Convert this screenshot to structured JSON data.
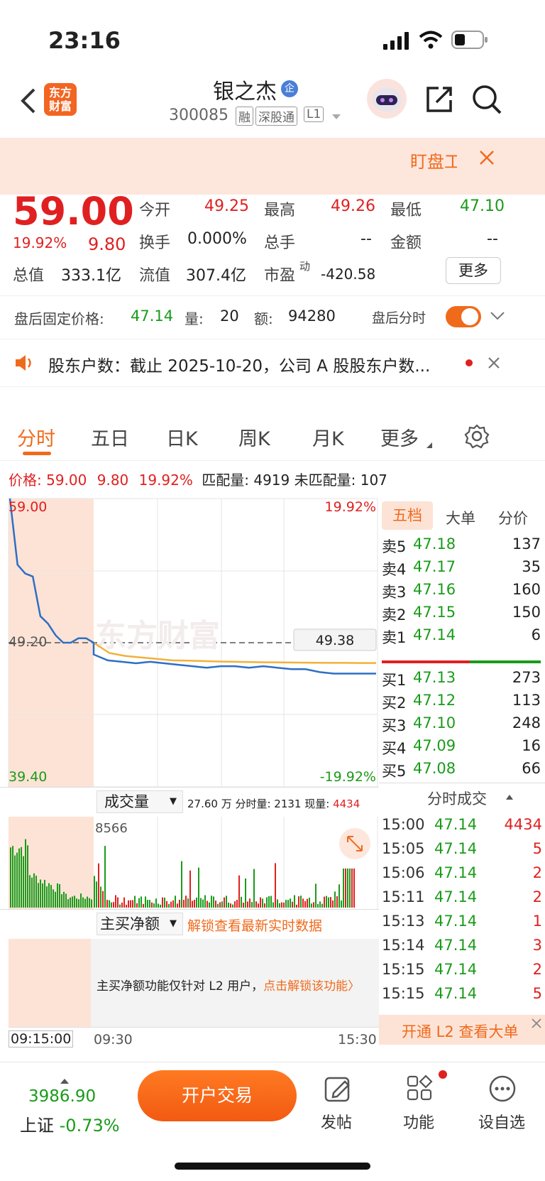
{
  "status": {
    "time": "23:16"
  },
  "header": {
    "back_icon": "chevron-left-icon",
    "logo_text": "东方财富",
    "title": "银之杰",
    "title_badge": "企",
    "code": "300085",
    "tags": [
      "融",
      "深股通",
      "L1"
    ]
  },
  "banner": {
    "text": "盯盘工",
    "close_icon": "close-icon"
  },
  "quote": {
    "price": "59.00",
    "change_pct": "19.92%",
    "change": "9.80",
    "open_label": "今开",
    "open": "49.25",
    "high_label": "最高",
    "high": "49.26",
    "low_label": "最低",
    "low": "47.10",
    "turnover_label": "换手",
    "turnover": "0.000%",
    "volume_label": "总手",
    "volume": "--",
    "amount_label": "金额",
    "amount": "--",
    "mcap_label": "总值",
    "mcap": "333.1亿",
    "float_label": "流值",
    "float": "307.4亿",
    "pe_label": "市盈",
    "pe_sup": "动",
    "pe": "-420.58",
    "more": "更多"
  },
  "after_hours": {
    "label": "盘后固定价格:",
    "price": "47.14",
    "vol_label": "量:",
    "vol": "20",
    "amt_label": "额:",
    "amt": "94280",
    "toggle_label": "盘后分时",
    "toggle_on": true
  },
  "notice": {
    "text": "股东户数：截止 2025-10-20，公司 A 股股东户数..."
  },
  "tabs": [
    "分时",
    "五日",
    "日K",
    "周K",
    "月K",
    "更多"
  ],
  "info_line": {
    "label": "价格:",
    "price": "59.00",
    "change": "9.80",
    "pct": "19.92%",
    "match_label": "匹配量:",
    "match": "4919",
    "unmatch_label": "未匹配量:",
    "unmatch": "107"
  },
  "chart_data": {
    "type": "line",
    "y_top": "59.00",
    "y_mid": "49.20",
    "y_bottom": "39.40",
    "pct_top": "19.92%",
    "pct_bottom": "-19.92%",
    "last_price_box": "49.38",
    "ylim": [
      39.4,
      59.0
    ],
    "price_series": [
      59.0,
      54.5,
      53.9,
      53.7,
      51.0,
      50.5,
      49.7,
      49.2,
      49.2,
      49.5,
      49.5,
      49.2,
      48.4,
      48.0,
      47.9,
      47.8,
      47.9,
      47.8,
      47.7,
      47.6,
      47.5,
      47.6,
      47.6,
      47.5,
      47.6,
      47.5,
      47.4,
      47.4,
      47.2,
      47.1,
      47.1,
      47.1,
      47.1
    ],
    "avg_series": [
      49.2,
      48.5,
      48.3,
      48.2,
      48.1,
      48.0,
      47.98,
      47.95,
      47.92,
      47.9,
      47.88,
      47.87,
      47.86,
      47.85,
      47.84,
      47.83,
      47.83,
      47.82,
      47.82
    ]
  },
  "volume_panel": {
    "selector": "成交量",
    "info": "27.60 万 分时量: 2131 现量:",
    "current": "4434",
    "max_label": "8566"
  },
  "netbuy_panel": {
    "selector": "主买净额",
    "unlock": "解锁查看最新实时数据",
    "message": "主买净额功能仅针对 L2 用户，",
    "link": "点击解锁该功能"
  },
  "time_axis": [
    "09:15:00",
    "09:30",
    "15:30"
  ],
  "orderbook": {
    "tabs": [
      "五档",
      "大单",
      "分价"
    ],
    "asks": [
      {
        "label": "卖5",
        "price": "47.18",
        "vol": "137"
      },
      {
        "label": "卖4",
        "price": "47.17",
        "vol": "35"
      },
      {
        "label": "卖3",
        "price": "47.16",
        "vol": "160"
      },
      {
        "label": "卖2",
        "price": "47.15",
        "vol": "150"
      },
      {
        "label": "卖1",
        "price": "47.14",
        "vol": "6"
      }
    ],
    "bids": [
      {
        "label": "买1",
        "price": "47.13",
        "vol": "273"
      },
      {
        "label": "买2",
        "price": "47.12",
        "vol": "113"
      },
      {
        "label": "买3",
        "price": "47.10",
        "vol": "248"
      },
      {
        "label": "买4",
        "price": "47.09",
        "vol": "16"
      },
      {
        "label": "买5",
        "price": "47.08",
        "vol": "66"
      }
    ]
  },
  "ticks": {
    "title": "分时成交",
    "rows": [
      {
        "time": "15:00",
        "price": "47.14",
        "vol": "4434",
        "color": "#e02020"
      },
      {
        "time": "15:05",
        "price": "47.14",
        "vol": "5",
        "color": "#e02020"
      },
      {
        "time": "15:06",
        "price": "47.14",
        "vol": "2",
        "color": "#e02020"
      },
      {
        "time": "15:11",
        "price": "47.14",
        "vol": "2",
        "color": "#e02020"
      },
      {
        "time": "15:13",
        "price": "47.14",
        "vol": "1",
        "color": "#e02020"
      },
      {
        "time": "15:14",
        "price": "47.14",
        "vol": "3",
        "color": "#e02020"
      },
      {
        "time": "15:15",
        "price": "47.14",
        "vol": "2",
        "color": "#e02020"
      },
      {
        "time": "15:15",
        "price": "47.14",
        "vol": "5",
        "color": "#e02020"
      }
    ],
    "l2_link": "开通 L2 查看大单"
  },
  "bottom": {
    "index_value": "3986.90",
    "index_name": "上证",
    "index_pct": "-0.73%",
    "trade_button": "开户交易",
    "post": "发帖",
    "function": "功能",
    "watch": "设自选"
  },
  "colors": {
    "accent": "#f06a1c",
    "up": "#e02020",
    "down": "#1a9b1a",
    "price_line": "#2e6fc4",
    "avg_line": "#f2b13a"
  }
}
